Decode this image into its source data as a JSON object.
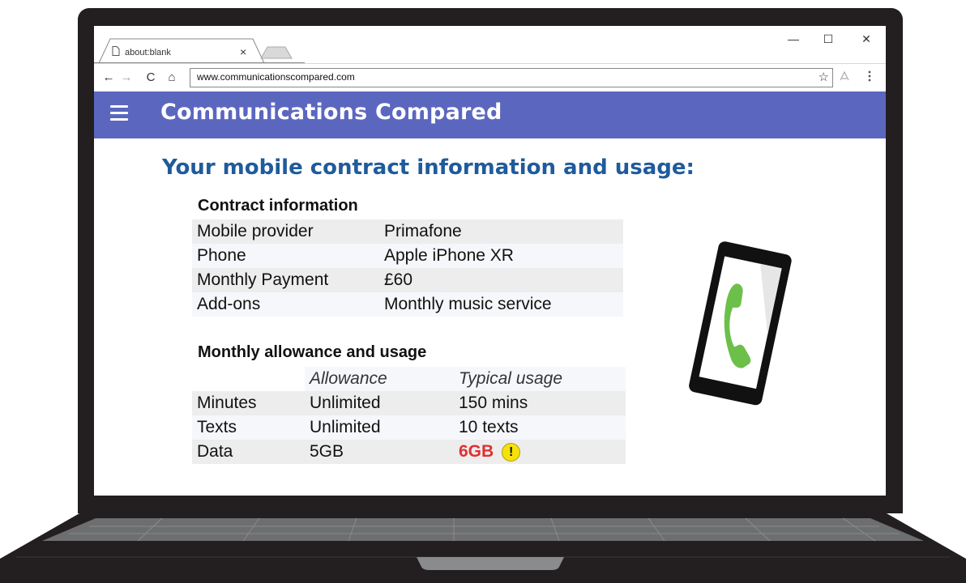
{
  "browser": {
    "tab_title": "about:blank",
    "tab_close": "×",
    "window_controls": {
      "minimize": "—",
      "maximize": "☐",
      "close": "✕"
    },
    "nav": {
      "back": "←",
      "forward": "→",
      "reload": "C",
      "home": "⌂"
    },
    "url": "www.communicationscompared.com",
    "bookmark_icon": "☆"
  },
  "site": {
    "title": "Communications Compared",
    "header_color": "#5b67bf"
  },
  "page": {
    "heading": "Your mobile contract information and usage:"
  },
  "contract": {
    "heading": "Contract information",
    "rows": [
      {
        "label": "Mobile provider",
        "value": "Primafone"
      },
      {
        "label": "Phone",
        "value": "Apple iPhone XR"
      },
      {
        "label": "Monthly Payment",
        "value": "£60"
      },
      {
        "label": "Add-ons",
        "value": "Monthly music service"
      }
    ]
  },
  "usage": {
    "heading": "Monthly allowance and usage",
    "columns": [
      "",
      "Allowance",
      "Typical usage"
    ],
    "rows": [
      {
        "label": "Minutes",
        "allowance": "Unlimited",
        "usage": "150 mins"
      },
      {
        "label": "Texts",
        "allowance": "Unlimited",
        "usage": "10 texts"
      },
      {
        "label": "Data",
        "allowance": "5GB",
        "usage": "6GB"
      }
    ],
    "warning_symbol": "!",
    "warning_color": "#e03030"
  },
  "icons": {
    "phone": "phone-icon",
    "warning": "warning-icon",
    "menu": "hamburger-icon"
  }
}
